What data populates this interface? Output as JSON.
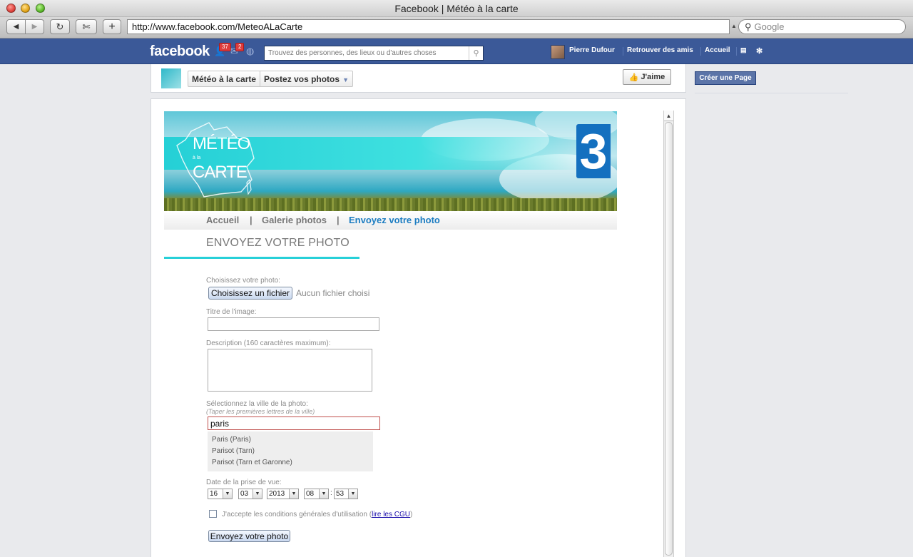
{
  "window": {
    "title": "Facebook | Météo à la carte"
  },
  "toolbar": {
    "url": "http://www.facebook.com/MeteoALaCarte",
    "search_placeholder": "Google"
  },
  "fb": {
    "logo": "facebook",
    "friend_requests": "37",
    "messages": "2",
    "search_placeholder": "Trouvez des personnes, des lieux ou d'autres choses",
    "user_name": "Pierre Dufour",
    "find_friends": "Retrouver des amis",
    "home": "Accueil"
  },
  "page": {
    "name": "Météo à la carte",
    "tab": "Postez vos photos",
    "like": "J'aime",
    "create_page": "Créer une Page"
  },
  "app": {
    "nav": [
      "Accueil",
      "Galerie photos",
      "Envoyez votre photo"
    ],
    "nav_sep": "|",
    "banner_title_top": "MÉTÉO",
    "banner_title_mid": "à la",
    "banner_title_bottom": "CARTE",
    "channel_number": "3",
    "heading": "ENVOYEZ VOTRE PHOTO",
    "photo_label": "Choisissez votre photo:",
    "file_button": "Choisissez un fichier",
    "file_none": "Aucun fichier choisi",
    "title_label": "Titre de l'image:",
    "title_value": "",
    "description_label": "Description (160 caractères maximum):",
    "description_value": "",
    "city_label": "Sélectionnez la ville de la photo:",
    "city_hint": "(Taper les premières lettres de la ville)",
    "city_value": "paris",
    "suggestions": [
      "Paris (Paris)",
      "Parisot (Tarn)",
      "Parisot (Tarn et Garonne)"
    ],
    "date_label": "Date de la prise de vue:",
    "date": {
      "day": "16",
      "month": "03",
      "year": "2013",
      "hour": "08",
      "minute": "53"
    },
    "time_sep": ":",
    "terms_text": "J'accepte les conditions générales d'utilisation",
    "terms_open": "(",
    "terms_link": "lire les CGU",
    "terms_close": ")",
    "submit": "Envoyez votre photo"
  },
  "colors": {
    "fb_blue": "#3b5998",
    "accent_cyan": "#27d0d8",
    "nav_active": "#1b7cc1"
  }
}
